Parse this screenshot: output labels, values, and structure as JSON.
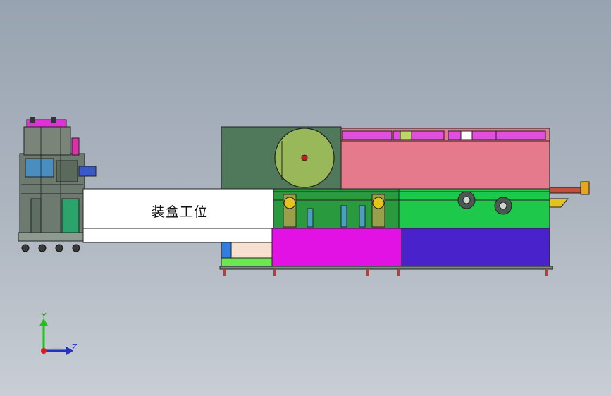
{
  "station_label": "装盒工位",
  "axis": {
    "y": "Y",
    "z": "Z"
  },
  "colors": {
    "background_top": "#98a3b1",
    "background_bottom": "#c9ced5",
    "frame_green": "#50785a",
    "panel_pink": "#e57a8c",
    "base_magenta": "#e312e4",
    "base_indigo": "#4a22cc",
    "conveyor_green": "#1dc84a",
    "wheel_olive": "#99b85a",
    "guard_white": "#ffffff",
    "feeder_yellow": "#e6c21c"
  }
}
